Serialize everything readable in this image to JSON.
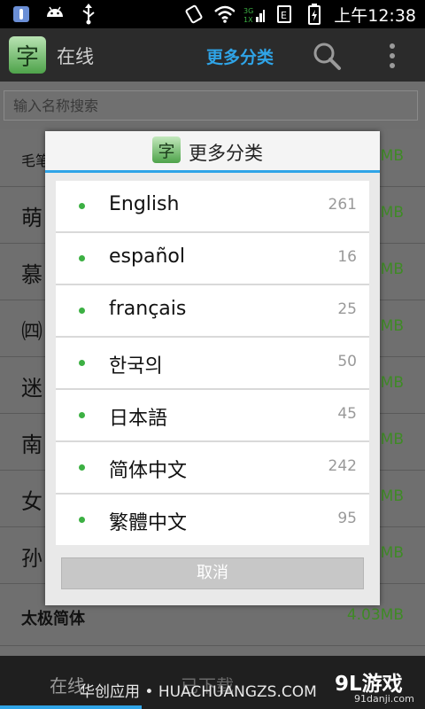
{
  "status_bar": {
    "time": "上午12:38"
  },
  "action_bar": {
    "logo_char": "字",
    "title": "在线",
    "more_categories": "更多分类"
  },
  "search": {
    "placeholder": "输入名称搜索"
  },
  "background_list": [
    {
      "glyph": "毛笔",
      "size": "MB"
    },
    {
      "glyph": "萌",
      "size": "MB"
    },
    {
      "glyph": "慕",
      "size": "MB"
    },
    {
      "glyph": "㈣",
      "size": "MB"
    },
    {
      "glyph": "迷",
      "size": "MB"
    },
    {
      "glyph": "南",
      "size": "MB"
    },
    {
      "glyph": "女",
      "size": "MB"
    },
    {
      "glyph": "孙",
      "size": "MB"
    },
    {
      "glyph": "太极简体",
      "size": "4.03MB"
    }
  ],
  "bottom_nav": {
    "online": "在线",
    "downloaded": "已下载"
  },
  "watermark": {
    "text": "华创应用 • HUACHUANGZS.COM",
    "logo": "9L游戏",
    "sub": "91danji.com"
  },
  "dialog": {
    "logo_char": "字",
    "title": "更多分类",
    "items": [
      {
        "label": "English",
        "count": "261"
      },
      {
        "label": "español",
        "count": "16"
      },
      {
        "label": "français",
        "count": "25"
      },
      {
        "label": "한국의",
        "count": "50"
      },
      {
        "label": "日本語",
        "count": "45"
      },
      {
        "label": "简体中文",
        "count": "242"
      },
      {
        "label": "繁體中文",
        "count": "95"
      }
    ],
    "cancel": "取消"
  },
  "colors": {
    "accent": "#2fa4e7",
    "bullet": "#3cb043",
    "size_text": "#3f8a26"
  }
}
